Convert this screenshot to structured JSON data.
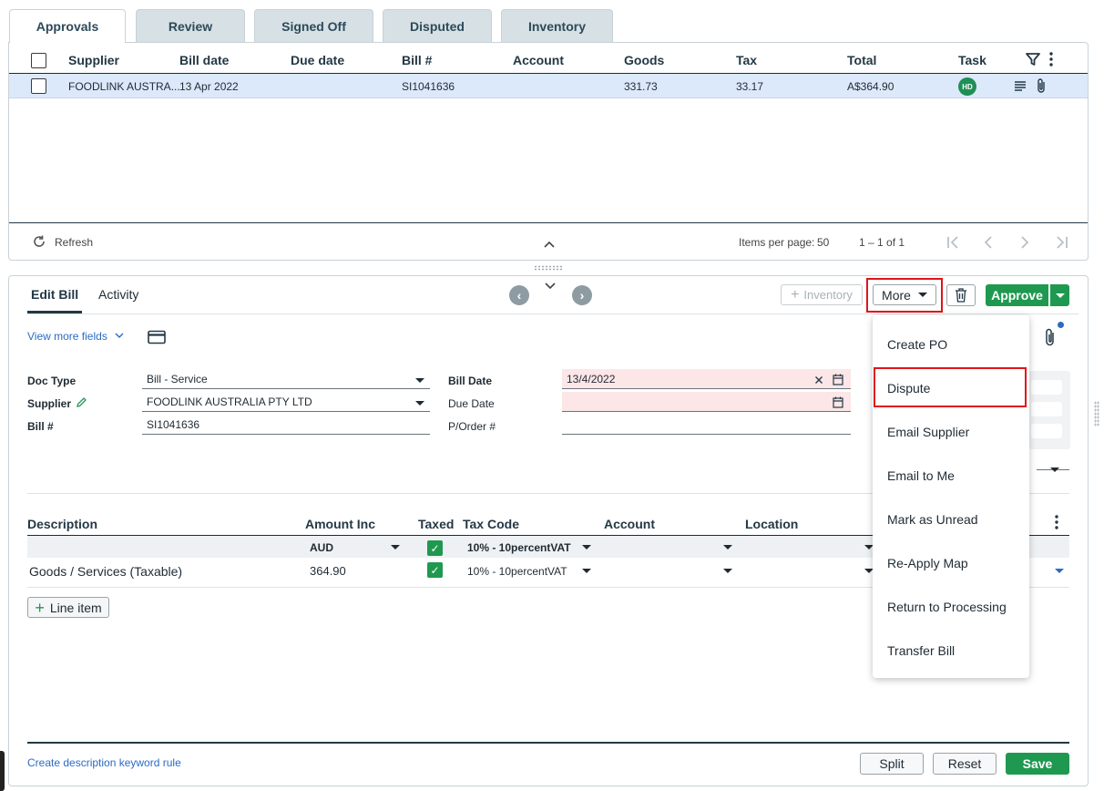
{
  "tabs": [
    "Approvals",
    "Review",
    "Signed Off",
    "Disputed",
    "Inventory"
  ],
  "grid": {
    "columns": [
      "Supplier",
      "Bill date",
      "Due date",
      "Bill #",
      "Account",
      "Goods",
      "Tax",
      "Total",
      "Task"
    ],
    "row": {
      "supplier": "FOODLINK AUSTRA...",
      "bill_date": "13 Apr 2022",
      "due_date": "",
      "bill_no": "SI1041636",
      "account": "",
      "goods": "331.73",
      "tax": "33.17",
      "total": "A$364.90",
      "task_avatar": "HD"
    },
    "refresh": "Refresh",
    "items_per_page_label": "Items per page:",
    "items_per_page": "50",
    "range": "1 – 1 of 1"
  },
  "detail": {
    "tabs": [
      "Edit Bill",
      "Activity"
    ],
    "inventory_btn": "Inventory",
    "more_btn": "More",
    "approve_btn": "Approve",
    "view_more": "View more fields",
    "fields": {
      "doc_type_label": "Doc Type",
      "doc_type": "Bill - Service",
      "supplier_label": "Supplier",
      "supplier": "FOODLINK AUSTRALIA PTY LTD",
      "bill_no_label": "Bill #",
      "bill_no": "SI1041636",
      "bill_date_label": "Bill Date",
      "bill_date": "13/4/2022",
      "due_date_label": "Due Date",
      "due_date": "",
      "po_label": "P/Order #",
      "po": ""
    },
    "lines": {
      "columns": [
        "Description",
        "Amount Inc",
        "Taxed",
        "Tax Code",
        "Account",
        "Location"
      ],
      "currency": "AUD",
      "default_tax_code": "10% - 10percentVAT",
      "items": [
        {
          "description": "Goods / Services (Taxable)",
          "amount": "364.90",
          "tax_code": "10% - 10percentVAT"
        }
      ],
      "add_line": "Line item"
    },
    "footer": {
      "keyword_rule": "Create description keyword rule",
      "split": "Split",
      "reset": "Reset",
      "save": "Save"
    }
  },
  "more_menu": [
    "Create PO",
    "Dispute",
    "Email Supplier",
    "Email to Me",
    "Mark as Unread",
    "Re-Apply Map",
    "Return to Processing",
    "Transfer Bill"
  ],
  "colors": {
    "accent_green": "#1f9950",
    "highlight_red": "#e0141a",
    "row_selected": "#dce9fb",
    "error_field": "#fce6e7"
  }
}
